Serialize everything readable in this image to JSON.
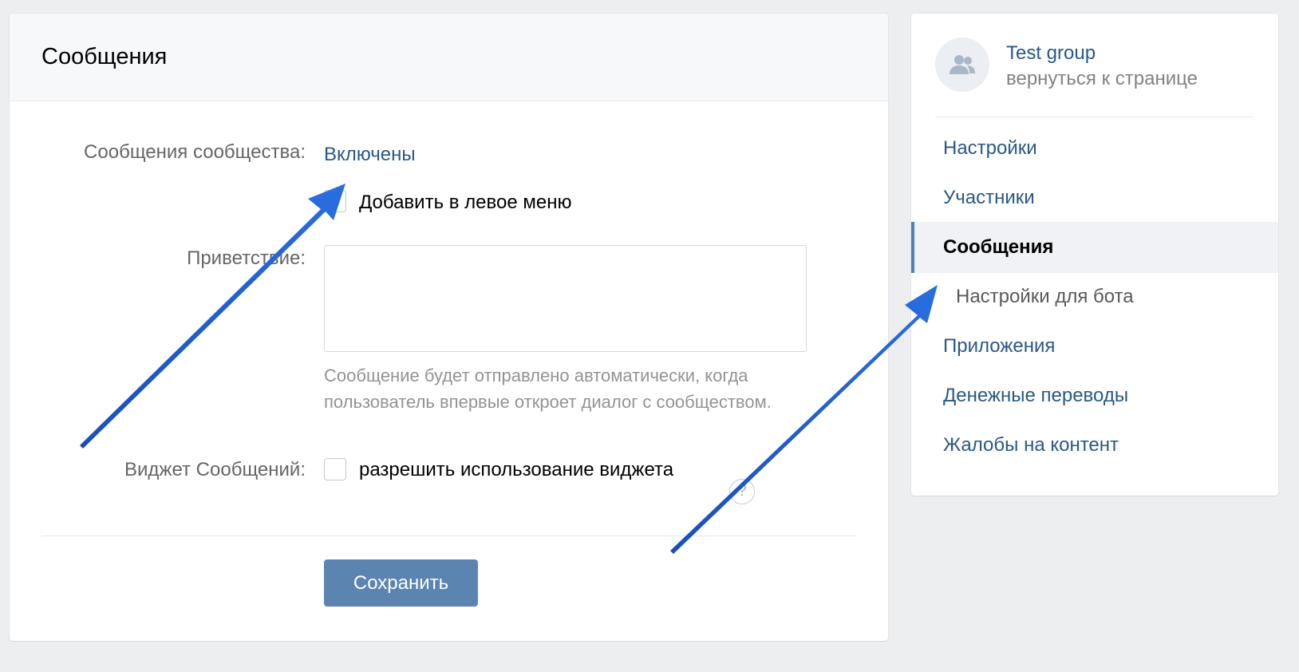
{
  "main": {
    "title": "Сообщения",
    "community_messages_label": "Сообщения сообщества:",
    "community_messages_status": "Включены",
    "add_to_menu_label": "Добавить в левое меню",
    "greeting_label": "Приветствие:",
    "greeting_value": "",
    "greeting_hint": "Сообщение будет отправлено автоматически, когда пользователь впервые откроет диалог с сообществом.",
    "widget_label": "Виджет Сообщений:",
    "widget_checkbox_label": "разрешить использование виджета",
    "help_glyph": "?",
    "save_label": "Сохранить"
  },
  "sidebar": {
    "group_name": "Test group",
    "back_link": "вернуться к странице",
    "avatar_icon": "group-icon",
    "items": [
      {
        "label": "Настройки",
        "active": false,
        "sub": false
      },
      {
        "label": "Участники",
        "active": false,
        "sub": false
      },
      {
        "label": "Сообщения",
        "active": true,
        "sub": false
      },
      {
        "label": "Настройки для бота",
        "active": false,
        "sub": true
      },
      {
        "label": "Приложения",
        "active": false,
        "sub": false
      },
      {
        "label": "Денежные переводы",
        "active": false,
        "sub": false
      },
      {
        "label": "Жалобы на контент",
        "active": false,
        "sub": false
      }
    ]
  },
  "colors": {
    "link": "#2a5885",
    "button": "#5b84b1",
    "active_bar": "#5181b8",
    "annotation_arrow": "#1f5bc8"
  }
}
